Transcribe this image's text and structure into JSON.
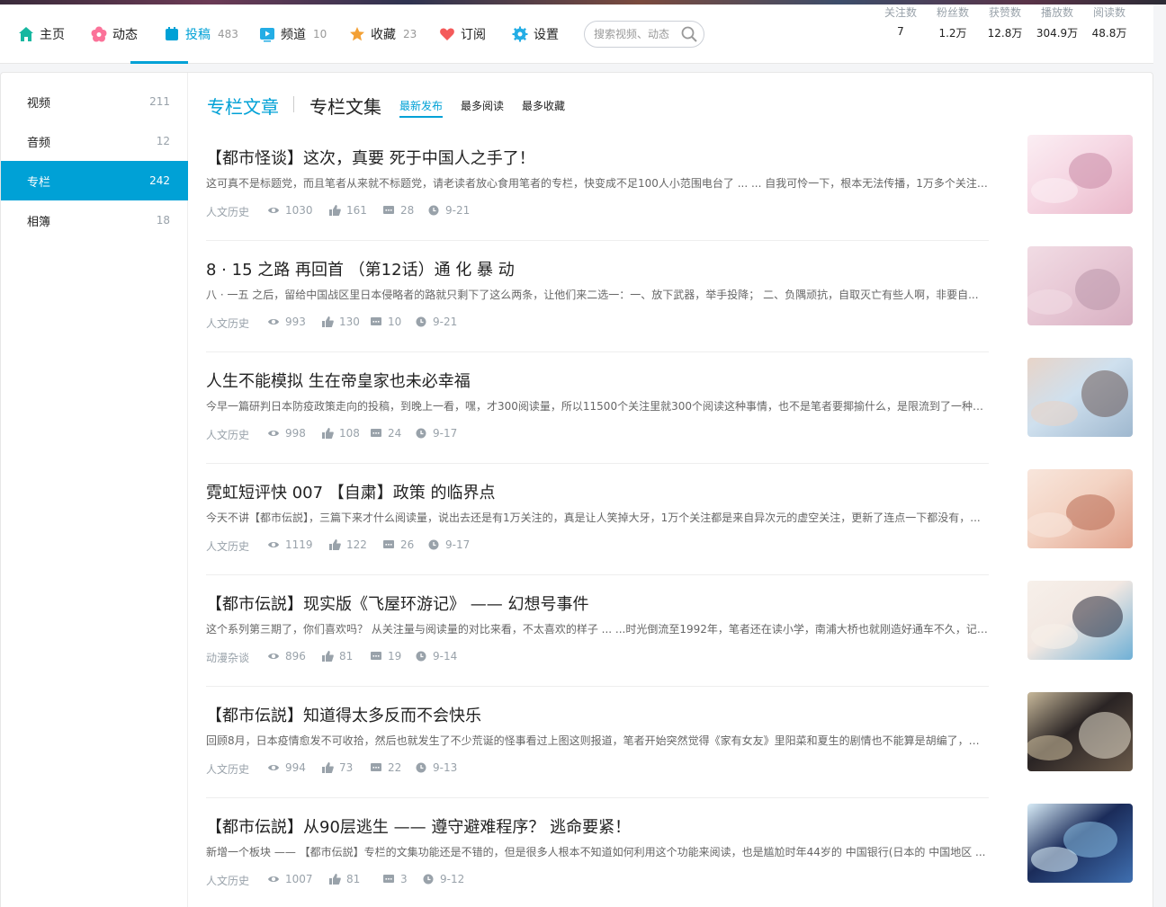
{
  "nav": {
    "items": [
      {
        "label": "主页",
        "count": ""
      },
      {
        "label": "动态",
        "count": ""
      },
      {
        "label": "投稿",
        "count": "483"
      },
      {
        "label": "频道",
        "count": "10"
      },
      {
        "label": "收藏",
        "count": "23"
      },
      {
        "label": "订阅",
        "count": ""
      },
      {
        "label": "设置",
        "count": ""
      }
    ],
    "search_placeholder": "搜索视频、动态",
    "stats": [
      {
        "label": "关注数",
        "value": "7"
      },
      {
        "label": "粉丝数",
        "value": "1.2万"
      },
      {
        "label": "获赞数",
        "value": "12.8万"
      },
      {
        "label": "播放数",
        "value": "304.9万"
      },
      {
        "label": "阅读数",
        "value": "48.8万"
      }
    ]
  },
  "sidebar": {
    "items": [
      {
        "label": "视频",
        "count": "211"
      },
      {
        "label": "音频",
        "count": "12"
      },
      {
        "label": "专栏",
        "count": "242"
      },
      {
        "label": "相簿",
        "count": "18"
      }
    ]
  },
  "tabs": {
    "articles": "专栏文章",
    "collections": "专栏文集"
  },
  "sort": {
    "latest": "最新发布",
    "most_read": "最多阅读",
    "most_fav": "最多收藏"
  },
  "articles": [
    {
      "title": "【都市怪谈】这次，真要 死于中国人之手了！",
      "desc": "这可真不是标题党，而且笔者从来就不标题党，请老读者放心食用笔者的专栏，快变成不足100人小范围电台了 ... ... 自我可怜一下，根本无法传播，1万多个关注全...",
      "category": "人文历史",
      "views": "1030",
      "likes": "161",
      "comments": "28",
      "date": "9-21"
    },
    {
      "title": "8 · 15 之路 再回首 （第12话）通 化 暴 动",
      "desc": "八 · 一五 之后，留给中国战区里日本侵略者的路就只剩下了这么两条，让他们来二选一：一、放下武器，举手投降； 二、负隅顽抗，自取灭亡有些人啊，非要自...",
      "category": "人文历史",
      "views": "993",
      "likes": "130",
      "comments": "10",
      "date": "9-21"
    },
    {
      "title": "人生不能模拟 生在帝皇家也未必幸福",
      "desc": "今早一篇研判日本防疫政策走向的投稿，到晚上一看，嘿，才300阅读量，所以11500个关注里就300个阅读这种事情，也不是笔者要揶揄什么，是限流到了一种境...",
      "category": "人文历史",
      "views": "998",
      "likes": "108",
      "comments": "24",
      "date": "9-17"
    },
    {
      "title": "霓虹短评快 007 【自粛】政策 的临界点",
      "desc": "今天不讲【都市伝説】，三篇下来才什么阅读量，说出去还是有1万关注的，真是让人笑掉大牙，1万个关注都是来自异次元的虚空关注，更新了连点一下都没有，...",
      "category": "人文历史",
      "views": "1119",
      "likes": "122",
      "comments": "26",
      "date": "9-17"
    },
    {
      "title": "【都市伝説】现实版《飞屋环游记》 —— 幻想号事件",
      "desc": "这个系列第三期了，你们喜欢吗？ 从关注量与阅读量的对比来看，不太喜欢的样子 ... ...时光倒流至1992年，笔者还在读小学，南浦大桥也就刚造好通车不久，记得...",
      "category": "动漫杂谈",
      "views": "896",
      "likes": "81",
      "comments": "19",
      "date": "9-14"
    },
    {
      "title": "【都市伝説】知道得太多反而不会快乐",
      "desc": "回顾8月，日本疫情愈发不可收拾，然后也就发生了不少荒诞的怪事看过上图这则报道，笔者开始突然觉得《家有女友》里阳菜和夏生的剧情也不能算是胡编了，虽...",
      "category": "人文历史",
      "views": "994",
      "likes": "73",
      "comments": "22",
      "date": "9-13"
    },
    {
      "title": "【都市伝説】从90层逃生 —— 遵守避难程序？ 逃命要紧！",
      "desc": "新增一个板块 —— 【都市伝説】专栏的文集功能还是不错的，但是很多人根本不知道如何利用这个功能来阅读，也是尴尬时年44岁的 中国银行(日本的 中国地区 ...",
      "category": "人文历史",
      "views": "1007",
      "likes": "81",
      "comments": "3",
      "date": "9-12"
    }
  ],
  "colors": {
    "accent": "#00a1d6",
    "muted": "#99a2aa"
  }
}
